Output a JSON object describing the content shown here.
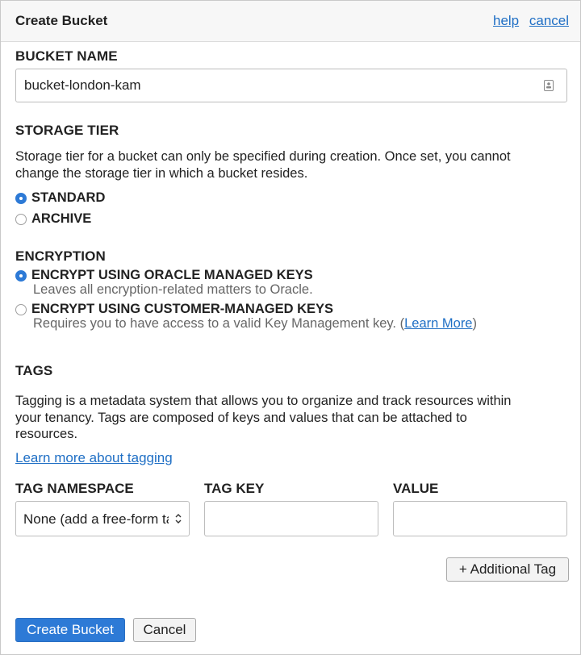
{
  "header": {
    "title": "Create Bucket",
    "help_link": "help",
    "cancel_link": "cancel"
  },
  "bucket_name": {
    "label": "BUCKET NAME",
    "value": "bucket-london-kam"
  },
  "storage_tier": {
    "label": "STORAGE TIER",
    "description_line1": "Storage tier for a bucket can only be specified during creation. Once set, you cannot",
    "description_line2": "change the storage tier in which a bucket resides.",
    "options": [
      {
        "label": "STANDARD",
        "checked": true
      },
      {
        "label": "ARCHIVE",
        "checked": false
      }
    ]
  },
  "encryption": {
    "label": "ENCRYPTION",
    "options": [
      {
        "label": "ENCRYPT USING ORACLE MANAGED KEYS",
        "description": "Leaves all encryption-related matters to Oracle.",
        "checked": true
      },
      {
        "label": "ENCRYPT USING CUSTOMER-MANAGED KEYS",
        "description_prefix": "Requires you to have access to a valid Key Management key. (",
        "description_link": "Learn More",
        "description_suffix": ")",
        "checked": false
      }
    ]
  },
  "tags": {
    "label": "TAGS",
    "description_line1": "Tagging is a metadata system that allows you to organize and track resources within",
    "description_line2": "your tenancy. Tags are composed of keys and values that can be attached to",
    "description_line3": "resources.",
    "learn_more_link": "Learn more about tagging",
    "namespace_label": "TAG NAMESPACE",
    "key_label": "TAG KEY",
    "value_label": "VALUE",
    "namespace_value": "None (add a free-form tag)",
    "key_value": "",
    "value_value": "",
    "additional_tag_button": "+ Additional Tag"
  },
  "footer": {
    "create_button": "Create Bucket",
    "cancel_button": "Cancel"
  },
  "colors": {
    "accent": "#2d7ad6",
    "link": "#1f6fc5",
    "header_bg": "#f7f7f7"
  },
  "icons": {
    "input_icon": "contact-card-icon",
    "select_icon": "chevron-up-down-icon"
  }
}
